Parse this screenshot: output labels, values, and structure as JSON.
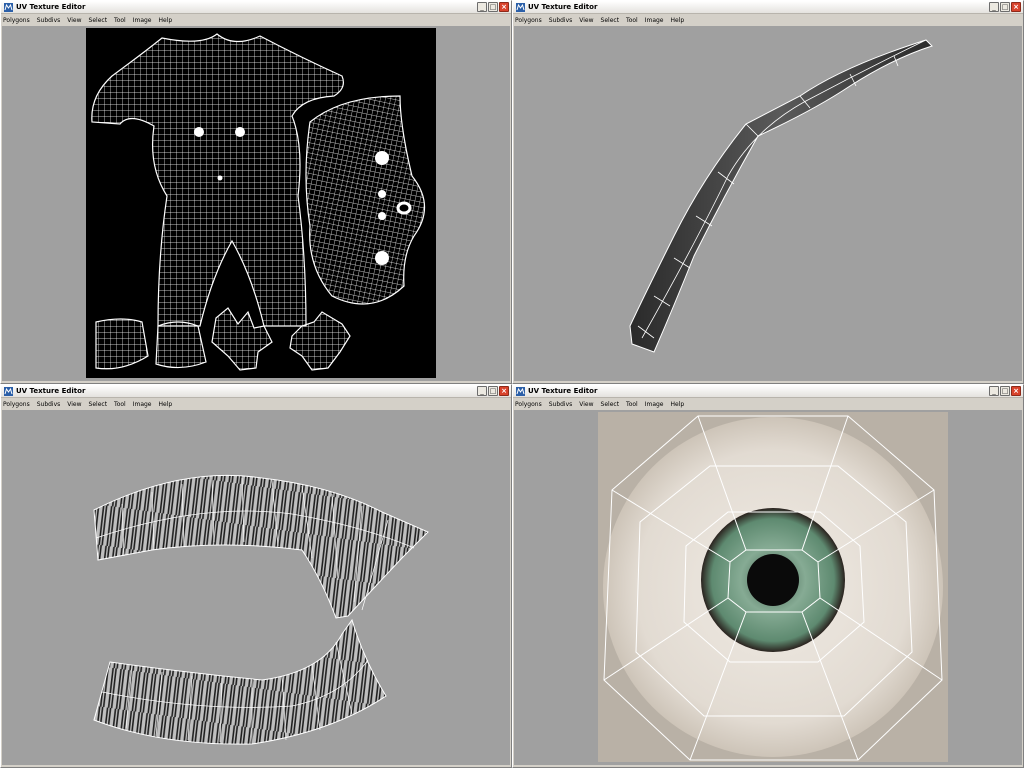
{
  "windows": [
    {
      "title": "UV Texture Editor",
      "menu": [
        "Polygons",
        "Subdivs",
        "View",
        "Select",
        "Tool",
        "Image",
        "Help"
      ],
      "content": "body-uv-layout"
    },
    {
      "title": "UV Texture Editor",
      "menu": [
        "Polygons",
        "Subdivs",
        "View",
        "Select",
        "Tool",
        "Image",
        "Help"
      ],
      "content": "eyebrow-strand-uv"
    },
    {
      "title": "UV Texture Editor",
      "menu": [
        "Polygons",
        "Subdivs",
        "View",
        "Select",
        "Tool",
        "Image",
        "Help"
      ],
      "content": "eyelashes-uv"
    },
    {
      "title": "UV Texture Editor",
      "menu": [
        "Polygons",
        "Subdivs",
        "View",
        "Select",
        "Tool",
        "Image",
        "Help"
      ],
      "content": "eyeball-uv"
    }
  ],
  "controls": {
    "minimize": "_",
    "restore": "□",
    "close": "×"
  },
  "colors": {
    "viewport_bg": "#a0a0a0",
    "wire": "#ffffff",
    "iris": "#5e8a70",
    "sclera": "#e6e0d8",
    "texture_bg": "#b9b1a6"
  },
  "icons": {
    "app": "maya-icon"
  }
}
